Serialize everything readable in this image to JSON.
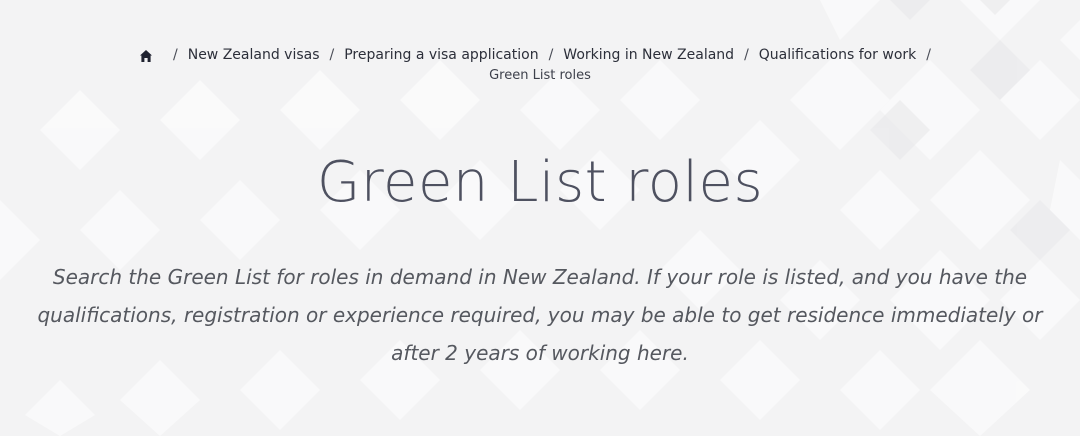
{
  "breadcrumb": {
    "home_icon": "home-icon",
    "items": [
      {
        "label": "New Zealand visas"
      },
      {
        "label": "Preparing a visa application"
      },
      {
        "label": "Working in New Zealand"
      },
      {
        "label": "Qualifications for work"
      }
    ],
    "separator": "/",
    "current": "Green List roles"
  },
  "page": {
    "title": "Green List roles",
    "intro": "Search the Green List for roles in demand in New Zealand. If your role is listed, and you have the qualifications, registration or experience required, you may be able to get residence immediately or after 2 years of working here."
  },
  "colors": {
    "background": "#f3f3f4",
    "pattern": "#ebebec",
    "text": "#4a4d57",
    "link": "#2c2f3a"
  }
}
